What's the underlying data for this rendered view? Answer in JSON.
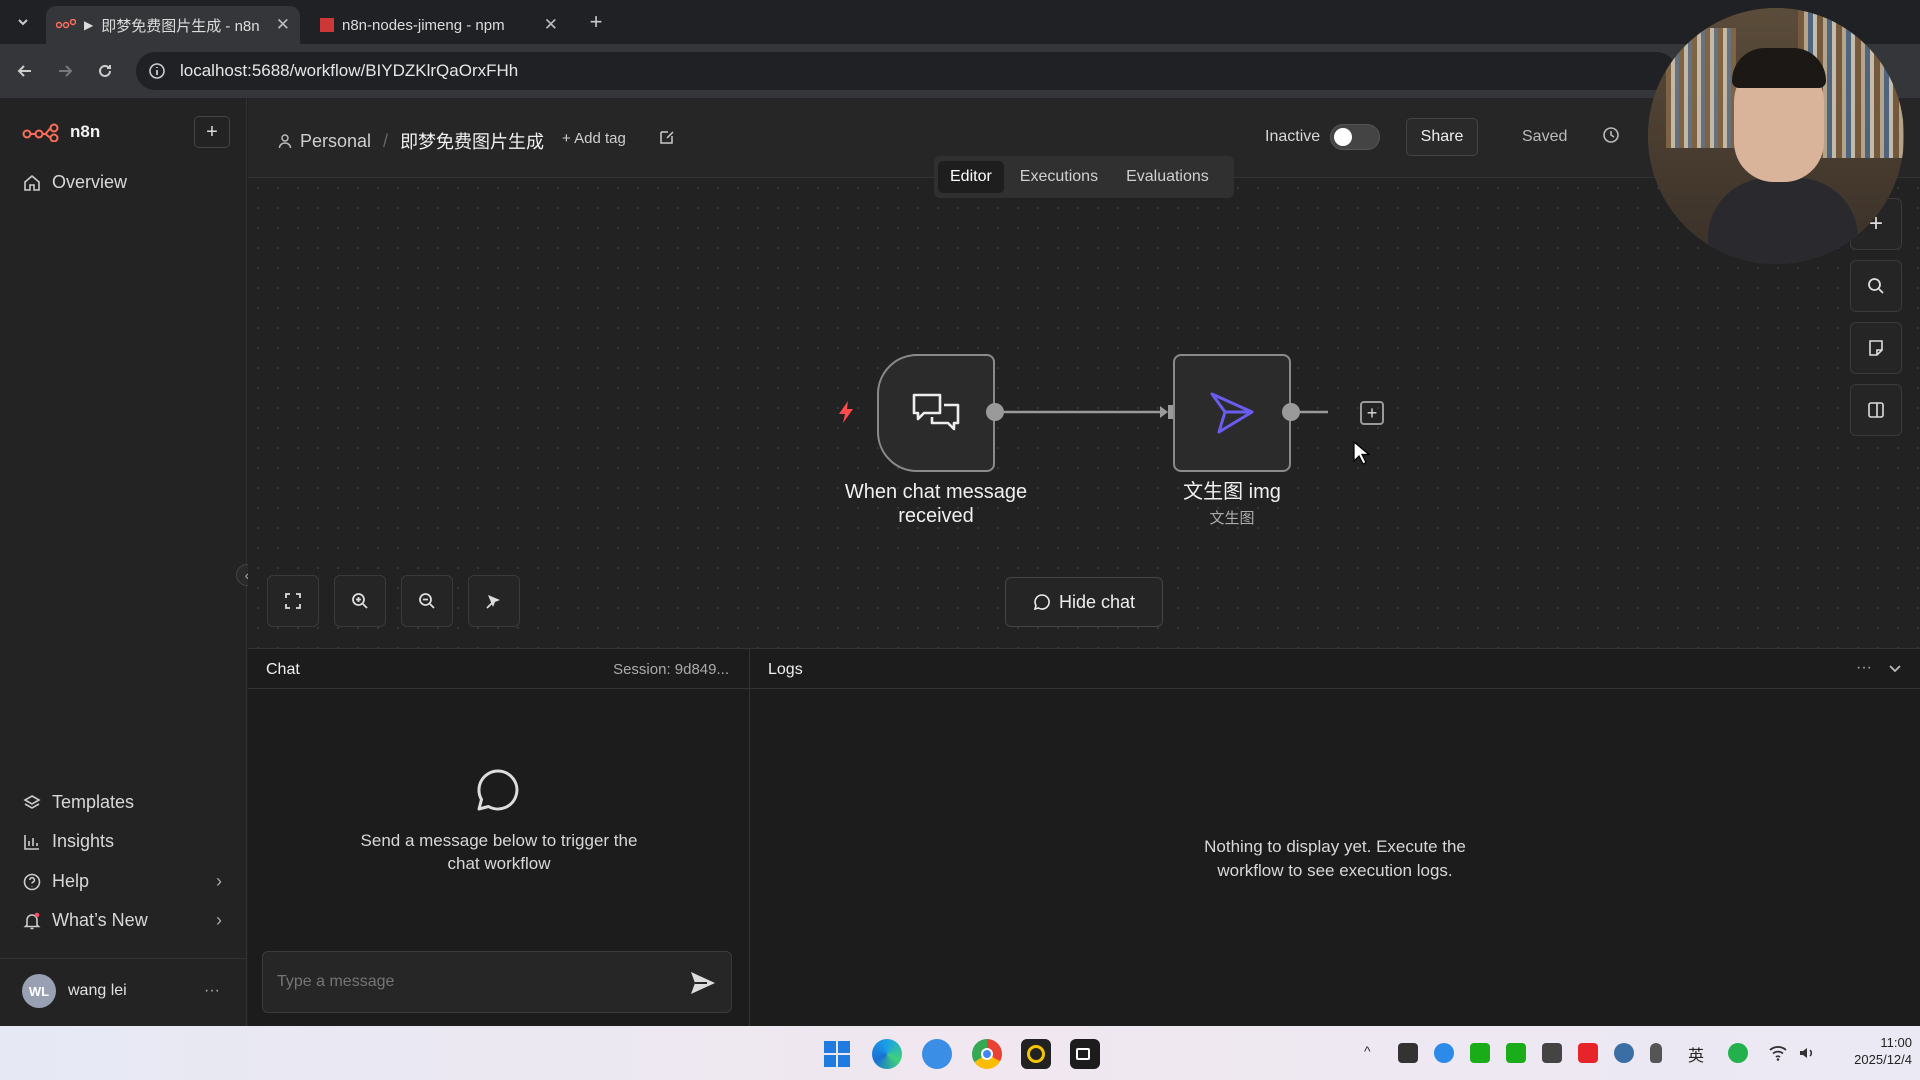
{
  "browser": {
    "tabs": [
      {
        "title": "即梦免费图片生成 - n8n",
        "active": true
      },
      {
        "title": "n8n-nodes-jimeng - npm",
        "active": false
      }
    ],
    "url": "localhost:5688/workflow/BIYDZKlrQaOrxFHh"
  },
  "sidebar": {
    "brand": "n8n",
    "overview": "Overview",
    "bottom_items": [
      {
        "label": "Templates",
        "icon": "templates-icon"
      },
      {
        "label": "Insights",
        "icon": "insights-icon"
      },
      {
        "label": "Help",
        "icon": "help-icon"
      },
      {
        "label": "What’s New",
        "icon": "bell-icon"
      }
    ],
    "user": {
      "initials": "WL",
      "name": "wang lei"
    }
  },
  "header": {
    "project": "Personal",
    "separator": "/",
    "workflow_name": "即梦免费图片生成",
    "add_tag": "+ Add tag",
    "status": "Inactive",
    "share": "Share",
    "saved": "Saved",
    "tabs": [
      "Editor",
      "Executions",
      "Evaluations"
    ],
    "active_tab": "Editor"
  },
  "canvas": {
    "nodes": [
      {
        "title": "When chat message received",
        "subtitle": ""
      },
      {
        "title": "文生图 img",
        "subtitle": "文生图"
      }
    ],
    "hide_chat": "Hide chat"
  },
  "chat": {
    "title": "Chat",
    "session": "Session: 9d849...",
    "empty_text": "Send a message below to trigger the chat workflow",
    "placeholder": "Type a message"
  },
  "logs": {
    "title": "Logs",
    "empty_text": "Nothing to display yet. Execute the workflow to see execution logs."
  },
  "taskbar": {
    "ime": "英",
    "time": "11:00",
    "date": "2025/12/4"
  },
  "colors": {
    "accent": "#ff6d5a",
    "node_icon": "#6b5cf0",
    "trigger": "#ff4d4d"
  }
}
